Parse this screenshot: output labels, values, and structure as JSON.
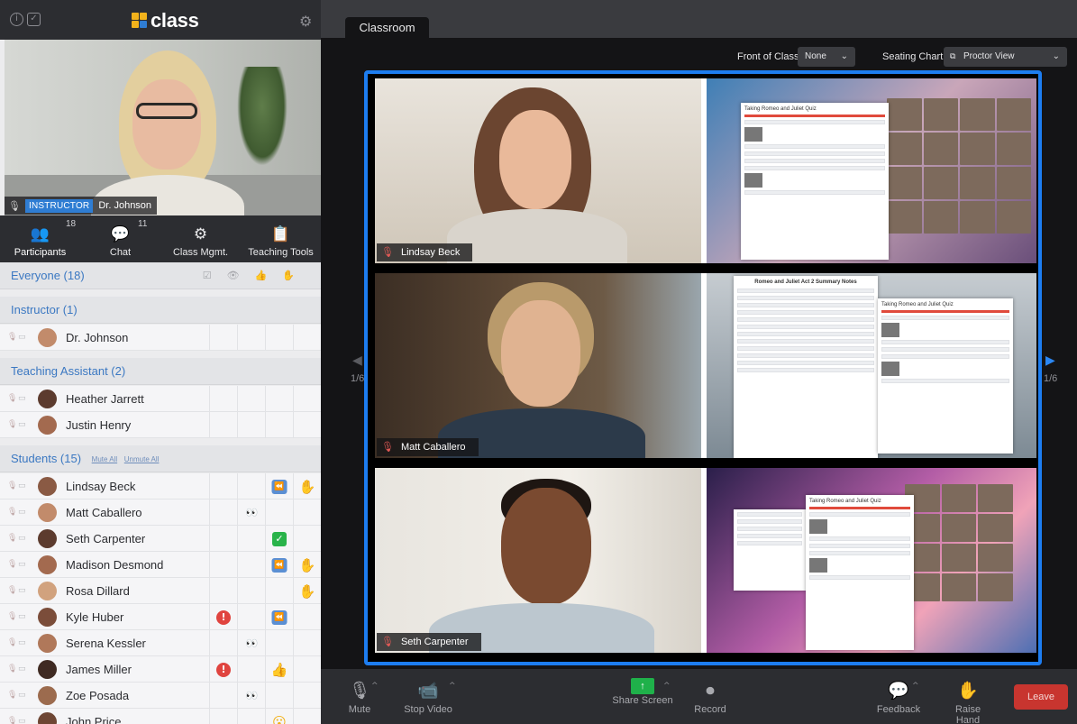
{
  "app": {
    "logo_text": "class",
    "brand_blue": "#1d7df0",
    "alert_red": "#e0443f",
    "success_green": "#1fb14a"
  },
  "instructor_video": {
    "badge": "INSTRUCTOR",
    "name": "Dr. Johnson"
  },
  "sidebar_tabs": [
    {
      "label": "Participants",
      "count": "18",
      "icon": "participants-icon"
    },
    {
      "label": "Chat",
      "count": "11",
      "icon": "chat-icon"
    },
    {
      "label": "Class Mgmt.",
      "count": "",
      "icon": "class-management-icon"
    },
    {
      "label": "Teaching Tools",
      "count": "",
      "icon": "teaching-tools-icon"
    }
  ],
  "sections": {
    "everyone": "Everyone (18)",
    "instructor": "Instructor (1)",
    "teaching_assistant": "Teaching Assistant (2)",
    "students": "Students (15)",
    "mute_all": "Mute All",
    "unmute_all": "Unmute All"
  },
  "instructors": [
    {
      "name": "Dr. Johnson"
    }
  ],
  "assistants": [
    {
      "name": "Heather Jarrett"
    },
    {
      "name": "Justin Henry"
    }
  ],
  "students": [
    {
      "name": "Lindsay Beck",
      "statuses": [
        "",
        "",
        "rewind",
        "hand"
      ]
    },
    {
      "name": "Matt Caballero",
      "statuses": [
        "",
        "eyes",
        "",
        ""
      ]
    },
    {
      "name": "Seth Carpenter",
      "statuses": [
        "",
        "",
        "check",
        ""
      ]
    },
    {
      "name": "Madison Desmond",
      "statuses": [
        "",
        "",
        "rewind",
        "hand"
      ]
    },
    {
      "name": "Rosa Dillard",
      "statuses": [
        "",
        "",
        "",
        "hand"
      ]
    },
    {
      "name": "Kyle Huber",
      "statuses": [
        "alert",
        "",
        "rewind",
        ""
      ]
    },
    {
      "name": "Serena Kessler",
      "statuses": [
        "",
        "eyes",
        "",
        ""
      ]
    },
    {
      "name": "James Miller",
      "statuses": [
        "alert",
        "",
        "thumbs-up",
        ""
      ]
    },
    {
      "name": "Zoe Posada",
      "statuses": [
        "",
        "eyes",
        "",
        ""
      ]
    },
    {
      "name": "John Price",
      "statuses": [
        "",
        "",
        "surprised",
        ""
      ]
    }
  ],
  "main": {
    "tab": "Classroom",
    "front_of_class_label": "Front of Class:",
    "front_of_class_value": "None",
    "seating_chart_label": "Seating Chart:",
    "seating_chart_value": "Proctor View",
    "page_left": "1/6",
    "page_right": "1/6"
  },
  "proctor_tiles": [
    {
      "name": "Lindsay Beck",
      "screen": "Taking Romeo and Juliet Quiz"
    },
    {
      "name": "Matt Caballero",
      "screen": "Romeo and Juliet Act 2 Summary Notes",
      "screen2": "Taking Romeo and Juliet Quiz"
    },
    {
      "name": "Seth Carpenter",
      "screen": "Taking Romeo and Juliet Quiz"
    }
  ],
  "toolbar": {
    "mute": "Mute",
    "stop_video": "Stop Video",
    "share_screen": "Share Screen",
    "record": "Record",
    "feedback": "Feedback",
    "raise_hand": "Raise Hand",
    "leave": "Leave"
  }
}
